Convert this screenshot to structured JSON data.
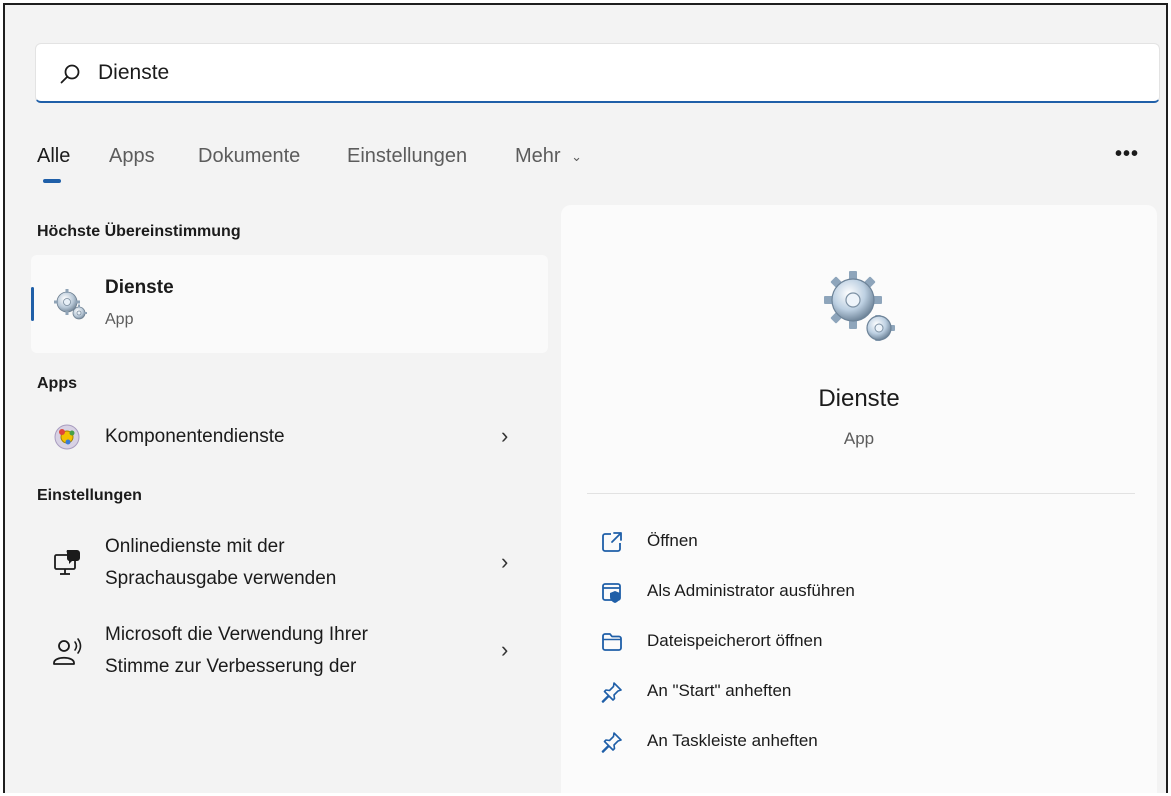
{
  "search": {
    "value": "Dienste",
    "icon": "search-icon"
  },
  "tabs": [
    {
      "label": "Alle",
      "active": true
    },
    {
      "label": "Apps"
    },
    {
      "label": "Dokumente"
    },
    {
      "label": "Einstellungen"
    },
    {
      "label": "Mehr"
    }
  ],
  "more_menu": "•••",
  "best_match": {
    "heading": "Höchste Übereinstimmung",
    "title": "Dienste",
    "subtitle": "App",
    "icon": "services-gear-icon"
  },
  "apps": {
    "heading": "Apps",
    "items": [
      {
        "label": "Komponentendienste",
        "icon": "component-services-icon"
      }
    ]
  },
  "settings": {
    "heading": "Einstellungen",
    "items": [
      {
        "line1": "Onlinedienste mit der",
        "line2": "Sprachausgabe verwenden",
        "icon": "speech-monitor-icon"
      },
      {
        "line1": "Microsoft die Verwendung Ihrer",
        "line2": "Stimme zur Verbesserung der",
        "icon": "voice-person-icon"
      }
    ]
  },
  "details": {
    "title": "Dienste",
    "subtitle": "App",
    "actions": [
      {
        "label": "Öffnen",
        "icon": "open-icon"
      },
      {
        "label": "Als Administrator ausführen",
        "icon": "admin-shield-icon"
      },
      {
        "label": "Dateispeicherort öffnen",
        "icon": "folder-icon"
      },
      {
        "label": "An \"Start\" anheften",
        "icon": "pin-icon"
      },
      {
        "label": "An Taskleiste anheften",
        "icon": "pin-icon"
      }
    ]
  },
  "colors": {
    "accent": "#1f5fa8",
    "background": "#f3f3f3",
    "panel": "#fbfbfb"
  }
}
